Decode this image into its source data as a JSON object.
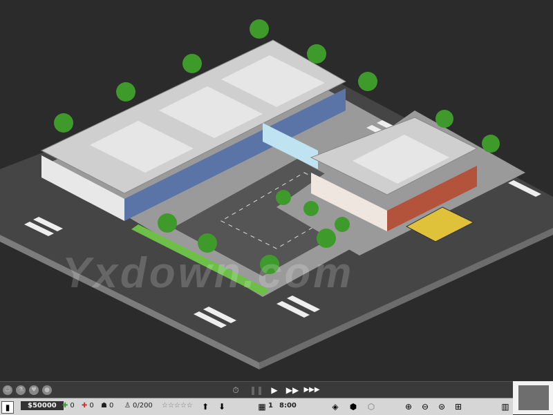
{
  "watermark": "Yxdown.com",
  "colors": {
    "background": "#2b2b2b",
    "road": "#454545",
    "sidewalk": "#9a9a9a",
    "roof": "#cfcfcf",
    "blue_facade": "#5a74a8",
    "brick_facade": "#b4533b",
    "grass": "#6dbf48",
    "tree": "#3f9a2c"
  },
  "toolbar_top": {
    "left_icons": [
      "smile-icon",
      "flask-icon",
      "heart-icon",
      "globe-icon"
    ],
    "time_icon": "stopwatch-icon",
    "speed_controls": [
      "pause-icon",
      "play-icon",
      "fast-forward-icon",
      "fastest-icon"
    ]
  },
  "toolbar_bottom": {
    "money": "$50000",
    "doctors": "0",
    "nurses": "0",
    "staff": "0",
    "patients": "0/200",
    "rating_stars": "☆☆☆☆☆",
    "day": "1",
    "time": "8:00"
  }
}
